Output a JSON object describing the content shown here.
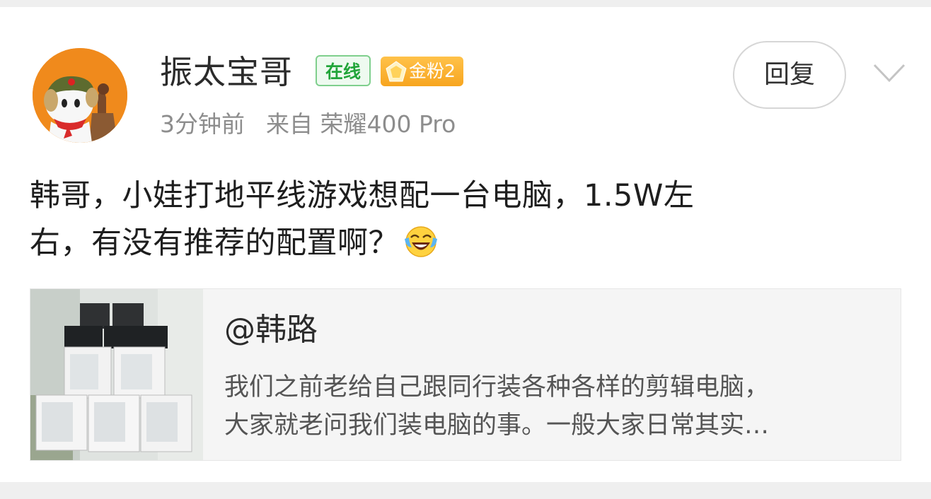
{
  "post": {
    "author": {
      "name": "振太宝哥",
      "online_label": "在线",
      "fan_badge": "金粉2",
      "avatar_icon": "mi-bunny-avatar-icon"
    },
    "time": "3分钟前",
    "source": "来自 荣耀400 Pro",
    "reply_label": "回复",
    "content_line1": "韩哥，小娃打地平线游戏想配一台电脑，1.5W左",
    "content_line2": "右，有没有推荐的配置啊？",
    "emoji_icon": "laugh-cry-emoji-icon"
  },
  "quote": {
    "author": "@韩路",
    "excerpt_line1": "我们之前老给自己跟同行装各种各样的剪辑电脑，",
    "excerpt_line2": "大家就老问我们装电脑的事。一般大家日常其实…"
  },
  "colors": {
    "online_green": "#22a53a",
    "gold_badge": "#f7a51f",
    "avatar_bg": "#f08a1c"
  }
}
